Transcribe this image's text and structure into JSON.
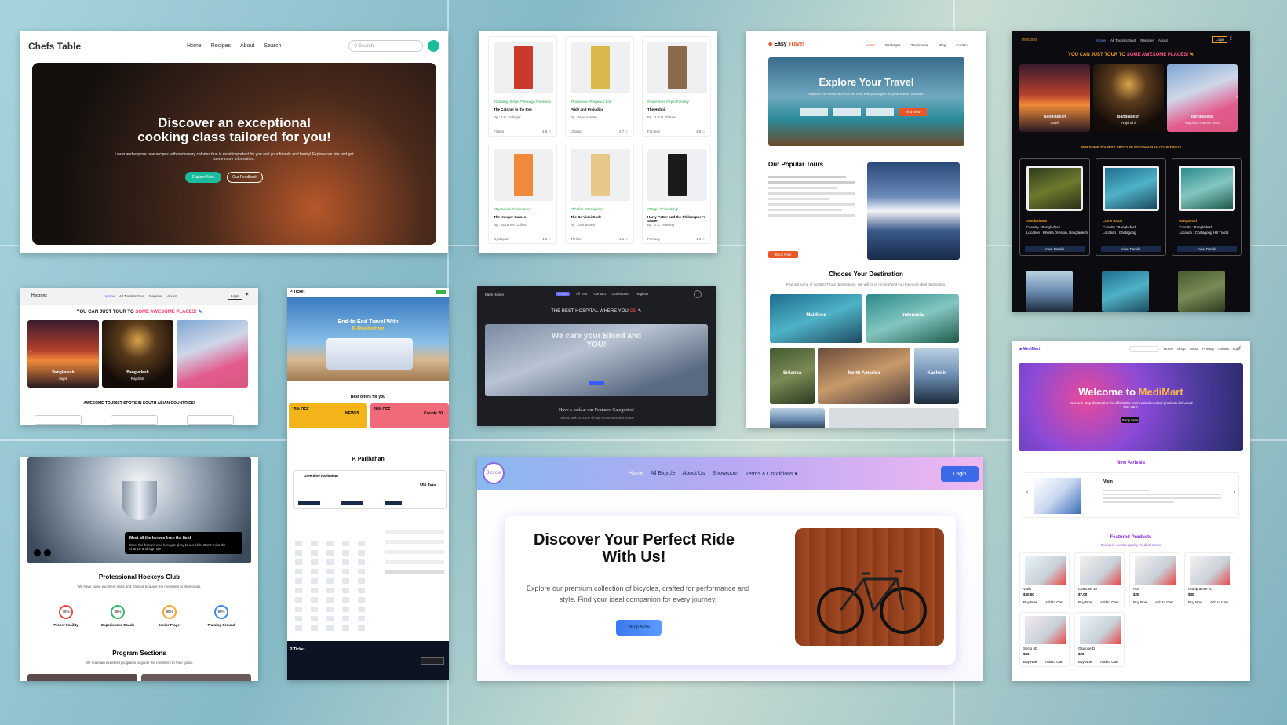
{
  "chefs": {
    "logo": "Chefs Table",
    "nav": [
      "Home",
      "Recipes",
      "About",
      "Search"
    ],
    "search_placeholder": "Search",
    "hero_title_1": "Discover an exceptional",
    "hero_title_2": "cooking class tailored for you!",
    "hero_sub": "Learn and explore new recipes with necessary calories that is most important for you and your friends and family! Explore our site and get some more information.",
    "btn_explore": "Explore Now",
    "btn_feedback": "Our Feedback"
  },
  "books": {
    "items": [
      {
        "title": "The Catcher in the Rye",
        "author": "By : J.D. Salinger",
        "tags": "#Coming of Age  #Teenage Rebellion",
        "cat": "Fiction",
        "rating": "4.6"
      },
      {
        "title": "Pride and Prejudice",
        "author": "By : Jane Austen",
        "tags": "#Romance  #Regency Era",
        "cat": "Classic",
        "rating": "4.7"
      },
      {
        "title": "The Hobbit",
        "author": "By : J.R.R. Tolkien",
        "tags": "#Adventure  #Epic Fantasy",
        "cat": "Fantasy",
        "rating": "4.8"
      },
      {
        "title": "The Hunger Games",
        "author": "By : Suzanne Collins",
        "tags": "#Dystopian  #Adventure",
        "cat": "Dystopian",
        "rating": "4.5"
      },
      {
        "title": "The Da Vinci Code",
        "author": "By : Dan Brown",
        "tags": "#Thriller  #Conspiracy",
        "cat": "Thriller",
        "rating": "4.1"
      },
      {
        "title": "Harry Potter and the Philosopher's Stone",
        "author": "By : J.K. Rowling",
        "tags": "#Magic  #Friendship",
        "cat": "Fantasy",
        "rating": "4.9"
      }
    ]
  },
  "easy": {
    "logo_a": "Easy",
    "logo_b": "Travel",
    "nav": [
      "Home",
      "Packages",
      "Testimonial",
      "Blog",
      "Contact"
    ],
    "hero": "Explore Your Travel",
    "hero_sub": "Explore the world and find the best tour packages for your dream vacation",
    "find_btn": "Find Now",
    "tours_title": "Our Popular Tours",
    "tours_btn": "Book Now",
    "dest_title": "Choose Your Destination",
    "dest_sub": "Find out some of our BEST tour destinations, We will try to recommend you the most ideal destination.",
    "dests": [
      "Maldives",
      "Indonesia",
      "Srilanka",
      "North America",
      "Kashmir"
    ]
  },
  "horizon": {
    "logo": "Horizons",
    "nav": [
      "Home",
      "All Tourists Spot",
      "Register",
      "About"
    ],
    "login": "Login",
    "headline_a": "YOU CAN JUST TOUR TO",
    "headline_b": "SOME AWESOME PLACES!",
    "slides": [
      {
        "t": "Bangladesh",
        "s": "Sajek"
      },
      {
        "t": "Bangladesh",
        "s": "Rajshahi"
      },
      {
        "t": "Bangladesh",
        "s": "Rajshahi Padma River"
      }
    ],
    "spots_title": "AWESOME TOURIST SPOTS IN SOUTH ASIAN COUNTRIES!",
    "spots": [
      {
        "n": "Sundarbans",
        "c": "Country : Bangladesh",
        "l": "Location : Khulna Division, Bangladesh",
        "b": "View Details"
      },
      {
        "n": "Cox's Bazar",
        "c": "Country : Bangladesh",
        "l": "Location : Chittagong",
        "b": "View Details"
      },
      {
        "n": "Rangamati",
        "c": "Country : Bangladesh",
        "l": "Location : Chittagong Hill Tracts",
        "b": "View Details"
      }
    ]
  },
  "horizon_light": {
    "logo": "Horizons",
    "nav": [
      "Home",
      "All Tourists Spot",
      "Register",
      "About"
    ],
    "login": "Login",
    "headline_a": "YOU CAN JUST TOUR TO",
    "headline_b": "SOME AWESOME PLACES!",
    "slides": [
      {
        "t": "Bangladesh",
        "s": "Sajek"
      },
      {
        "t": "Bangladesh",
        "s": "Rajshahi"
      }
    ],
    "spots_title": "AWESOME TOURIST SPOTS IN SOUTH ASIAN COUNTRIES!"
  },
  "ticket": {
    "logo": "P-Ticket",
    "hero_a": "End-to-End Travel With",
    "hero_b": "P-Poribahan",
    "offers": "Best offers for you",
    "off1": "15% OFF",
    "code1": "NEW15",
    "off2": "20% OFF",
    "code2": "Couple 20",
    "company": "P. Paribahan",
    "route": "Greenline Paribahan",
    "price": "550 Taka",
    "footer_logo": "P-Ticket"
  },
  "hospital": {
    "logo": "Medi Haven",
    "nav": [
      "Home",
      "All Test",
      "Contact",
      "Dashboard",
      "Register"
    ],
    "title_a": "THE BEST HOSPITAL WHERE YOU",
    "title_b": "GE",
    "hero_a": "We care your Blood and",
    "hero_b": "YOU!",
    "featured": "Have a look at our Featured Categories!",
    "featured_sub": "Take a look at some of our recommended Tests!"
  },
  "bicycle": {
    "logo": "Bicycle",
    "nav": [
      "Home",
      "All Bicycle",
      "About Us",
      "Showroom",
      "Terms & Conditions"
    ],
    "login": "Login",
    "title_1": "Discover Your Perfect Ride",
    "title_2": "With Us!",
    "desc": "Explore our premium collection of bicycles, crafted for performance and style. Find your ideal companion for every journey.",
    "shop": "Shop Now"
  },
  "hockey": {
    "caption_title": "Meet all the heroes from the field",
    "caption_sub": "Meet the heroes who brought glory to our club. Don't miss the chance and sign up!",
    "title": "Professional Hockeys Club",
    "sub": "We have some excellent skills and training to guide the members to their goals.",
    "stats": [
      {
        "v": "75%",
        "n": "Proper Facility"
      },
      {
        "v": "85%",
        "n": "Experienced Coach"
      },
      {
        "v": "90%",
        "n": "Senior Player"
      },
      {
        "v": "95%",
        "n": "Training Ground"
      }
    ],
    "section": "Program Sections",
    "section_sub": "We maintain excellent programs to guide the members to their goals."
  },
  "medimart": {
    "logo": "MediMart",
    "nav": [
      "Home",
      "Shop",
      "About",
      "Privacy",
      "Orders",
      "Login"
    ],
    "hero_a": "Welcome to",
    "hero_b": "MediMart",
    "hero_sub": "Your one-stop destination for affordable and trusted medical products delivered with care.",
    "hero_btn": "Shop Now",
    "arrivals": "New Arrivals",
    "product": "Visin",
    "featured": "Featured Products",
    "featured_sub": "Discover our top quality medical items",
    "products": [
      {
        "n": "Visin",
        "p": "$30.00"
      },
      {
        "n": "Cetrizine 10",
        "p": "$7.00"
      },
      {
        "n": "Ace",
        "p": "$20"
      },
      {
        "n": "Omeprazole 20",
        "p": "$30"
      },
      {
        "n": "Seclo 40",
        "p": "$30"
      },
      {
        "n": "Glucose D",
        "p": "$20"
      }
    ],
    "buy": "Buy Now",
    "cart": "Add to Cart"
  }
}
